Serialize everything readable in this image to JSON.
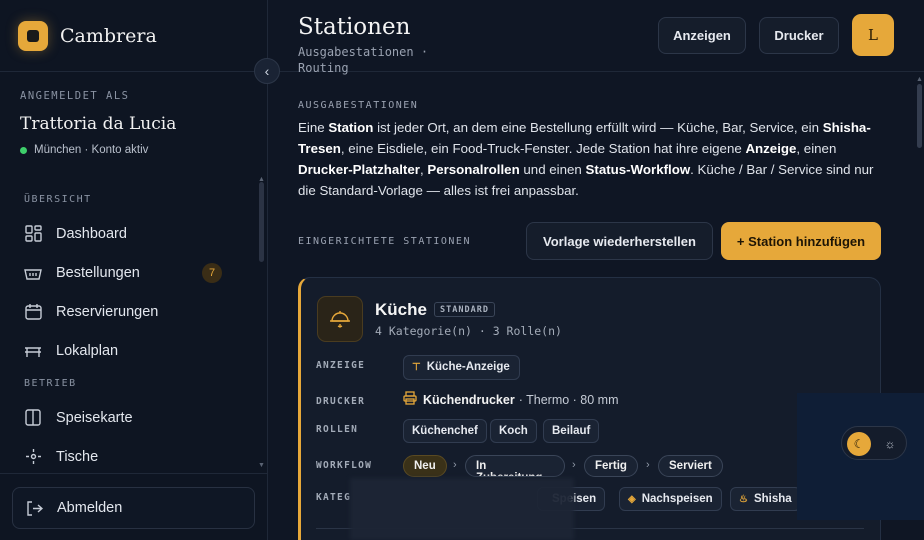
{
  "brand": {
    "name": "Cambrera"
  },
  "account": {
    "label": "ANGEMELDET ALS",
    "name": "Trattoria da Lucia",
    "status": "München · Konto aktiv"
  },
  "nav": {
    "section_overview": "ÜBERSICHT",
    "section_operations": "BETRIEB",
    "items": [
      {
        "label": "Dashboard",
        "icon": "dashboard-grid-icon"
      },
      {
        "label": "Bestellungen",
        "icon": "basket-icon",
        "badge": "7"
      },
      {
        "label": "Reservierungen",
        "icon": "calendar-icon"
      },
      {
        "label": "Lokalplan",
        "icon": "table-icon"
      },
      {
        "label": "Speisekarte",
        "icon": "menu-book-icon"
      },
      {
        "label": "Tische",
        "icon": "crosshair-icon"
      }
    ],
    "logout": "Abmelden"
  },
  "header": {
    "title": "Stationen",
    "subtitle": "Ausgabestationen · Routing",
    "display_button": "Anzeigen",
    "printer_button": "Drucker",
    "avatar_initial": "L"
  },
  "intro": {
    "section_label": "AUSGABESTATIONEN",
    "parts": {
      "p1": "Eine ",
      "b1": "Station",
      "p2": " ist jeder Ort, an dem eine Bestellung erfüllt wird — Küche, Bar, Service, ein ",
      "b2": "Shisha-Tresen",
      "p3": ", eine Eisdiele, ein Food-Truck-Fenster. Jede Station hat ihre eigene ",
      "b3": "Anzeige",
      "p4": ", einen ",
      "b4": "Drucker-Platzhalter",
      "p5": ", ",
      "b5": "Personalrollen",
      "p6": " und einen ",
      "b6": "Status-Workflow",
      "p7": ". Küche / Bar / Service sind nur die Standard-Vorlage — alles ist frei anpassbar."
    }
  },
  "stations": {
    "section_label": "EINGERICHTETE STATIONEN",
    "restore_button": "Vorlage wiederherstellen",
    "add_button": "+ Station hinzufügen"
  },
  "station_card": {
    "name": "Küche",
    "badge": "STANDARD",
    "meta": "4 Kategorie(n) · 3 Rolle(n)",
    "labels": {
      "display": "ANZEIGE",
      "printer": "DRUCKER",
      "roles": "ROLLEN",
      "workflow": "WORKFLOW",
      "categories": "KATEG"
    },
    "display_value": "Küche-Anzeige",
    "printer_name": "Küchendrucker",
    "printer_detail": "· Thermo · 80 mm",
    "roles": [
      "Küchenchef",
      "Koch",
      "Beilauf"
    ],
    "workflow": [
      "Neu",
      "In Zubereitung",
      "Fertig",
      "Serviert"
    ],
    "categories": [
      "Speisen",
      "Nachspeisen",
      "Shisha"
    ]
  },
  "colors": {
    "accent": "#e6a83a",
    "background": "#0f1624",
    "status_ok": "#3ecf6b"
  }
}
